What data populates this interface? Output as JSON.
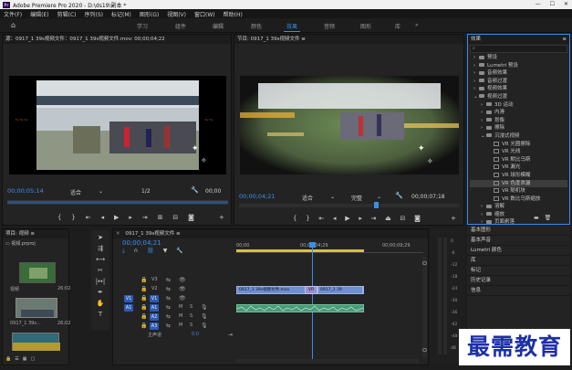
{
  "window": {
    "title": "Adobe Premiere Pro 2020 - D:\\ds19\\副本 *",
    "min": "—",
    "max": "☐",
    "close": "✕"
  },
  "menu": [
    "文件(F)",
    "编辑(E)",
    "剪辑(C)",
    "序列(S)",
    "标记(M)",
    "图形(G)",
    "视图(V)",
    "窗口(W)",
    "帮助(H)"
  ],
  "workspaces": {
    "items": [
      "学习",
      "组件",
      "编辑",
      "颜色",
      "效果",
      "音频",
      "图形",
      "库"
    ],
    "active": "效果",
    "more": "»"
  },
  "source_monitor": {
    "header": "源：0917_1 39s视频文件：0917_1 39s视频文件.mov: 00;00;04;22",
    "menu": "≡",
    "timecode": "00;00;05;14",
    "fit": "适合",
    "resolution": "1/2",
    "end_timecode": "00;00"
  },
  "program_monitor": {
    "header": "节目: 0917_1 39s视频文件 ≡",
    "timecode": "00;00;04;21",
    "fit": "适合",
    "resolution": "完整",
    "end_timecode": "00;00;07;18"
  },
  "effects_panel": {
    "title": "效果",
    "menu": "≡",
    "search_placeholder": "",
    "rows": [
      {
        "label": "预设",
        "type": "folder",
        "indent": 0,
        "expanded": false
      },
      {
        "label": "Lumetri 预设",
        "type": "folder",
        "indent": 0,
        "expanded": false
      },
      {
        "label": "音频效果",
        "type": "folder",
        "indent": 0,
        "expanded": false
      },
      {
        "label": "音频过渡",
        "type": "folder",
        "indent": 0,
        "expanded": false
      },
      {
        "label": "视频效果",
        "type": "folder",
        "indent": 0,
        "expanded": false
      },
      {
        "label": "视频过渡",
        "type": "folder",
        "indent": 0,
        "expanded": true
      },
      {
        "label": "3D 运动",
        "type": "folder",
        "indent": 1,
        "expanded": false
      },
      {
        "label": "内滑",
        "type": "folder",
        "indent": 1,
        "expanded": false
      },
      {
        "label": "划像",
        "type": "folder",
        "indent": 1,
        "expanded": false
      },
      {
        "label": "擦除",
        "type": "folder",
        "indent": 1,
        "expanded": false
      },
      {
        "label": "沉浸式视频",
        "type": "folder",
        "indent": 1,
        "expanded": true
      },
      {
        "label": "VR 光圈擦除",
        "type": "fx",
        "indent": 2
      },
      {
        "label": "VR 光线",
        "type": "fx",
        "indent": 2
      },
      {
        "label": "VR 默比乌斯",
        "type": "fx",
        "indent": 2
      },
      {
        "label": "VR 漏光",
        "type": "fx",
        "indent": 2
      },
      {
        "label": "VR 球形模糊",
        "type": "fx",
        "indent": 2
      },
      {
        "label": "VR 色度泄漏",
        "type": "fx",
        "indent": 2,
        "selected": true
      },
      {
        "label": "VR 随机块",
        "type": "fx",
        "indent": 2
      },
      {
        "label": "VR 数比乌斯缩放",
        "type": "fx",
        "indent": 2
      },
      {
        "label": "溶解",
        "type": "folder",
        "indent": 1,
        "expanded": false
      },
      {
        "label": "缩放",
        "type": "folder",
        "indent": 1,
        "expanded": false
      },
      {
        "label": "页面剥落",
        "type": "folder",
        "indent": 1,
        "expanded": false
      }
    ]
  },
  "side_panels": [
    "基本图形",
    "基本声音",
    "Lumetri 颜色",
    "库",
    "标记",
    "历史记录",
    "信息"
  ],
  "project_panel": {
    "header": "项目: 视频 ≡",
    "file": "视频.prproj",
    "clips": [
      {
        "name": "视频",
        "duration": "26;02"
      },
      {
        "name": "0917_1 39s...",
        "duration": "26;02"
      },
      {
        "name": "",
        "duration": ""
      }
    ]
  },
  "timeline": {
    "header": "0917_1 39s视频文件 ≡",
    "timecode": "00;00;04;21",
    "ruler": [
      "00;00",
      "00;00;04;29",
      "00;00;09;29"
    ],
    "video_tracks": [
      "V3",
      "V2",
      "V1"
    ],
    "audio_tracks": [
      "A1",
      "A2",
      "A3"
    ],
    "source_v": "V1",
    "source_a": "A1",
    "master": "主声道",
    "master_value": "0.0",
    "clip_v1_a": "0917_1 39s视频文件.mov",
    "clip_v1_b": "0917_1 39",
    "transition": "VR",
    "m": "M",
    "s": "S"
  },
  "meter_labels": [
    "0",
    "-6",
    "-12",
    "-18",
    "-24",
    "-30",
    "-36",
    "-42",
    "-48",
    "dB"
  ],
  "watermark": "最需教育",
  "colors": {
    "accent": "#3a8ee8",
    "clip_video": "#6f8fcf",
    "clip_audio": "#4a9a7a",
    "watermark": "#2233aa"
  }
}
